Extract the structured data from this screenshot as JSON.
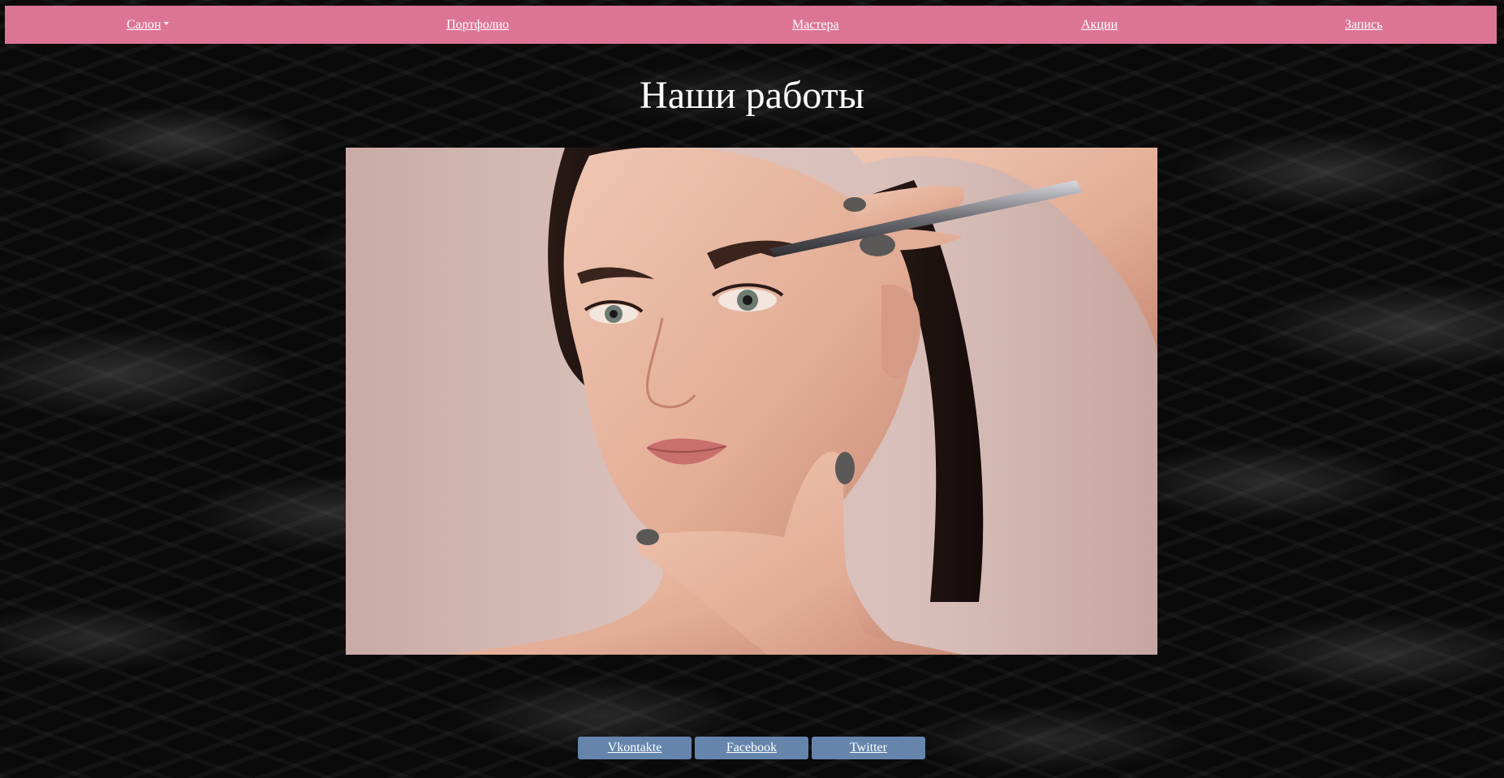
{
  "nav": {
    "salon": "Салон",
    "portfolio": "Портфолио",
    "masters": "Мастера",
    "promotions": "Акции",
    "booking": "Запись"
  },
  "title": "Наши работы",
  "social": {
    "vk": "Vkontakte",
    "facebook": "Facebook",
    "twitter": "Twitter"
  },
  "colors": {
    "navbar": "#dc7595",
    "social_button": "#6585ad",
    "background": "#0a0a0a"
  },
  "icons": {
    "dropdown": "caret-down-icon"
  }
}
